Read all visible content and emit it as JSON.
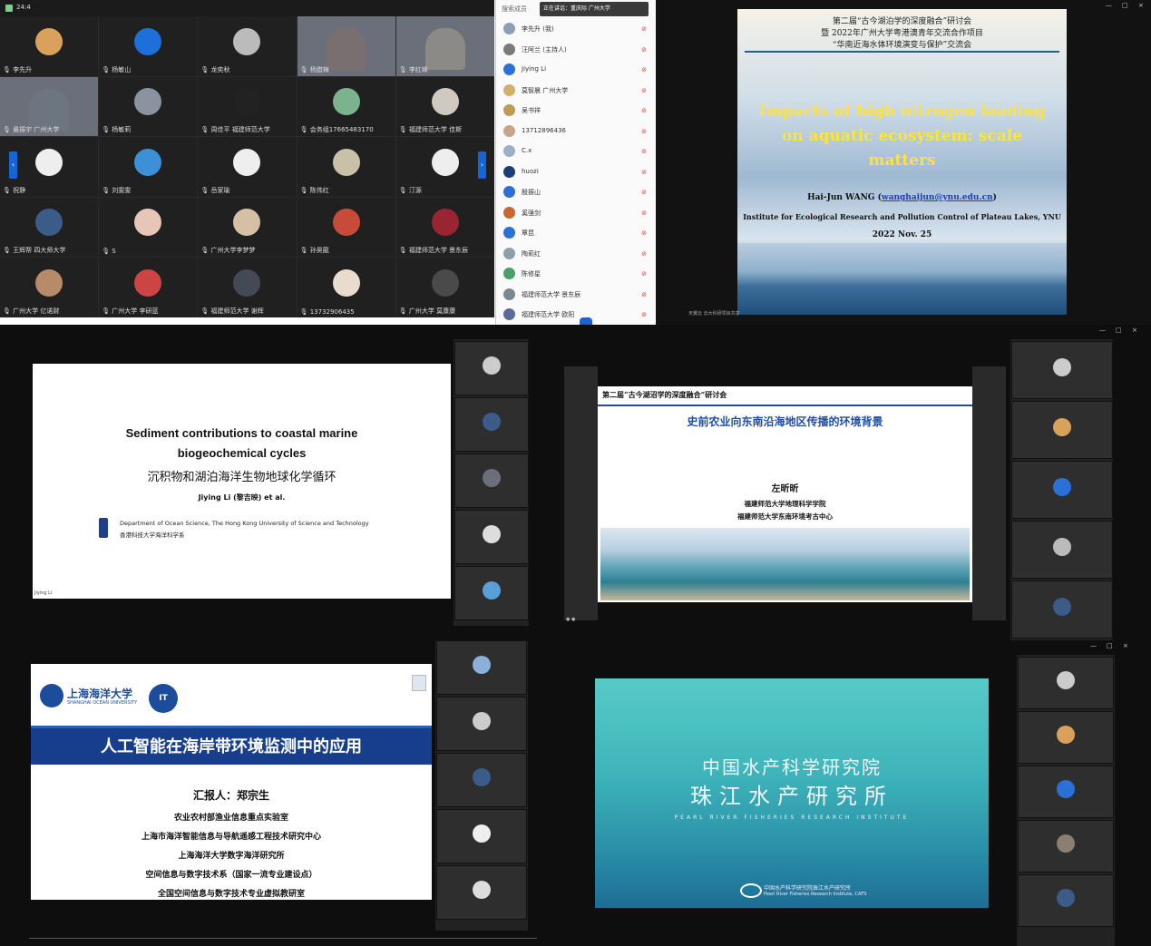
{
  "meeting": {
    "top_label": "24:4",
    "tiles": [
      {
        "name": "李先升",
        "color": "#d9a15b"
      },
      {
        "name": "杨敏山",
        "color": "#1e6fd9"
      },
      {
        "name": "龙奕秋",
        "color": "#bbbbbb"
      },
      {
        "name": "杨腊梅",
        "color": "#7a6f70",
        "video": true
      },
      {
        "name": "李红峰",
        "color": "#8c8a86",
        "video": true
      },
      {
        "name": "悬振宇 广州大学",
        "color": "#6d7580",
        "video": true
      },
      {
        "name": "杨敏莉",
        "color": "#8b93a0"
      },
      {
        "name": "周佳平 福建师范大学",
        "color": "#222222"
      },
      {
        "name": "会务组17665483170",
        "color": "#7bb38f"
      },
      {
        "name": "福建师范大学 佳斯",
        "color": "#cfc9c2"
      },
      {
        "name": "祝静",
        "color": "#eeeeee"
      },
      {
        "name": "刘雯雯",
        "color": "#3d8fd6"
      },
      {
        "name": "岳家瑜",
        "color": "#eeeeee"
      },
      {
        "name": "陈伟红",
        "color": "#c8c1a8"
      },
      {
        "name": "汀源",
        "color": "#eeeeee"
      },
      {
        "name": "王辉帮 四大师大学",
        "color": "#3b5b89"
      },
      {
        "name": "S",
        "color": "#e8c6b7"
      },
      {
        "name": "广州大学李梦梦",
        "color": "#d6c0a5"
      },
      {
        "name": "孙昊龍",
        "color": "#c84b3a"
      },
      {
        "name": "福建师范大学 景东辰",
        "color": "#9a2432"
      },
      {
        "name": "广州大学 亿诺财",
        "color": "#b78a6a"
      },
      {
        "name": "广州大学 李研蓝",
        "color": "#cc4444"
      },
      {
        "name": "福建师范大学 谢辉",
        "color": "#444a55"
      },
      {
        "name": "13732906435",
        "color": "#e9dccc"
      },
      {
        "name": "广州大学 莫康康",
        "color": "#4a4a4a"
      }
    ]
  },
  "participants": {
    "search_placeholder": "搜索成员",
    "tooltip": "正在讲话：重庆际 广州大学",
    "items": [
      {
        "name": "李先升",
        "sub": "(我)"
      },
      {
        "name": "汪阿兰",
        "sub": "(主持人)"
      },
      {
        "name": "Jiying Li",
        "sub": ""
      },
      {
        "name": "莫智晨 广州大学",
        "sub": ""
      },
      {
        "name": "吴书祥",
        "sub": ""
      },
      {
        "name": "13712896436",
        "sub": ""
      },
      {
        "name": "C.x",
        "sub": ""
      },
      {
        "name": "huozi",
        "sub": ""
      },
      {
        "name": "殷振山",
        "sub": ""
      },
      {
        "name": "奚强剑",
        "sub": ""
      },
      {
        "name": "覃昆",
        "sub": ""
      },
      {
        "name": "陶莉红",
        "sub": ""
      },
      {
        "name": "陈修星",
        "sub": ""
      },
      {
        "name": "福建师范大学 景东辰",
        "sub": ""
      },
      {
        "name": "福建师范大学 欧阳",
        "sub": ""
      }
    ]
  },
  "slide1": {
    "header_line1": "第二届“古今湖泊学的深度融合”研讨会",
    "header_line2": "暨 2022年广州大学粤港澳青年交流合作项目",
    "header_line3": "“华南近海水体环境演变与保护”交流会",
    "title": "Impacts of high nitrogen loading on aquatic ecosystem: scale matters",
    "author": "Hai-Jun WANG (",
    "email": "wanghaijun@ynu.edu.cn",
    "author_end": ")",
    "institute": "Institute for Ecological Research and Pollution Control of Plateau Lakes, YNU",
    "date": "2022 Nov. 25",
    "footer": "天翼云 云大科研项目共享"
  },
  "slide2": {
    "title_en": "Sediment contributions to coastal marine biogeochemical cycles",
    "title_cn": "沉积物和湖泊海洋生物地球化学循环",
    "author": "Jiying Li (黎吉映) et al.",
    "dept_en": "Department of Ocean Science, The Hong Kong University of Science and Technology",
    "dept_cn": "香港科技大学海洋科学系",
    "footer": "Jiying Li"
  },
  "slide3": {
    "header": "第二届“古今湖沼学的深度融合”研讨会",
    "title": "史前农业向东南沿海地区传播的环境背景",
    "author": "左昕昕",
    "inst1": "福建师范大学地理科学学院",
    "inst2": "福建师范大学东南环境考古中心"
  },
  "slide4": {
    "logo_text": "上海海洋大学",
    "logo_en": "SHANGHAI OCEAN UNIVERSITY",
    "title": "人工智能在海岸带环境监测中的应用",
    "reporter": "汇报人：郑宗生",
    "lines": [
      "农业农村部渔业信息重点实验室",
      "上海市海洋智能信息与导航遥感工程技术研究中心",
      "上海海洋大学数字海洋研究所",
      "空间信息与数字技术系（国家一流专业建设点）",
      "全国空间信息与数字技术专业虚拟教研室"
    ]
  },
  "slide5": {
    "line1": "中国水产科学研究院",
    "line2": "珠江水产研究所",
    "line_en": "PEARL RIVER FISHERIES RESEARCH INSTITUTE",
    "footer_cn": "中国水产科学研究院珠江水产研究所",
    "footer_en": "Pearl River Fisheries Research Institute, CAFS"
  },
  "window_controls": {
    "minimize": "—",
    "maximize": "□",
    "close": "×"
  },
  "colors": {
    "accent_blue": "#0e3d8f",
    "slide_bg_teal": "#3fbcc0",
    "slide1_title": "#ffe23a",
    "slide3_title": "#1f4ea8"
  }
}
